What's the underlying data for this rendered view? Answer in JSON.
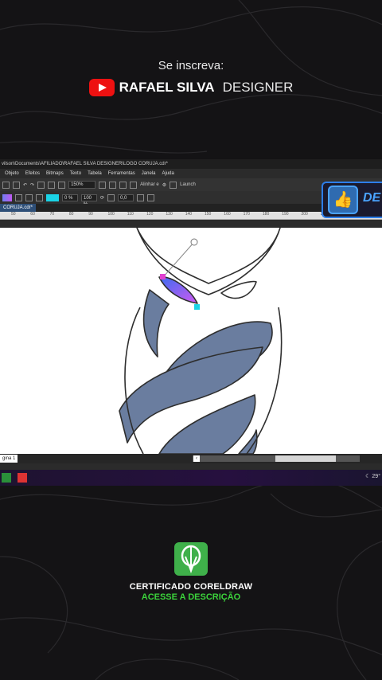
{
  "banner": {
    "subscribe_text": "Se inscreva:",
    "channel_name_bold": "RAFAEL SILVA",
    "channel_name_thin": "DESIGNER"
  },
  "app": {
    "title_path": "vilson\\Documents\\AFILIADO\\RAFAEL SILVA DESIGNER\\LOGO CORUJA.cdr*",
    "menu": [
      "Objeto",
      "Efeitos",
      "Bitmaps",
      "Texto",
      "Tabela",
      "Ferramentas",
      "Janela",
      "Ajuda"
    ],
    "toolbar": {
      "zoom_value": "150%",
      "align_label": "Alinhar e",
      "launch_label": "Launch"
    },
    "propbar": {
      "percent_value": "0 %",
      "percent_value_2": "100 %",
      "outline_value": "0,0"
    },
    "document_tab": "CORUJA.cdr*",
    "ruler_ticks": [
      "50",
      "60",
      "70",
      "80",
      "90",
      "100",
      "110",
      "120",
      "130",
      "140",
      "150",
      "160",
      "170",
      "180",
      "190",
      "200",
      "210",
      "220",
      "230"
    ],
    "page_tab": "gina 1",
    "tray_text": "29°"
  },
  "like_badge": {
    "text": "DE"
  },
  "certificate": {
    "title": "CERTIFICADO CORELDRAW",
    "subtitle": "ACESSE A DESCRIÇÃO"
  },
  "colors": {
    "logo_fill": "#6a7d9f",
    "gradient_start": "#3b6cf0",
    "gradient_end": "#d05af2",
    "accent_cyan": "#1ad3e6",
    "youtube_red": "#e11111",
    "corel_green": "#3fb04a"
  }
}
